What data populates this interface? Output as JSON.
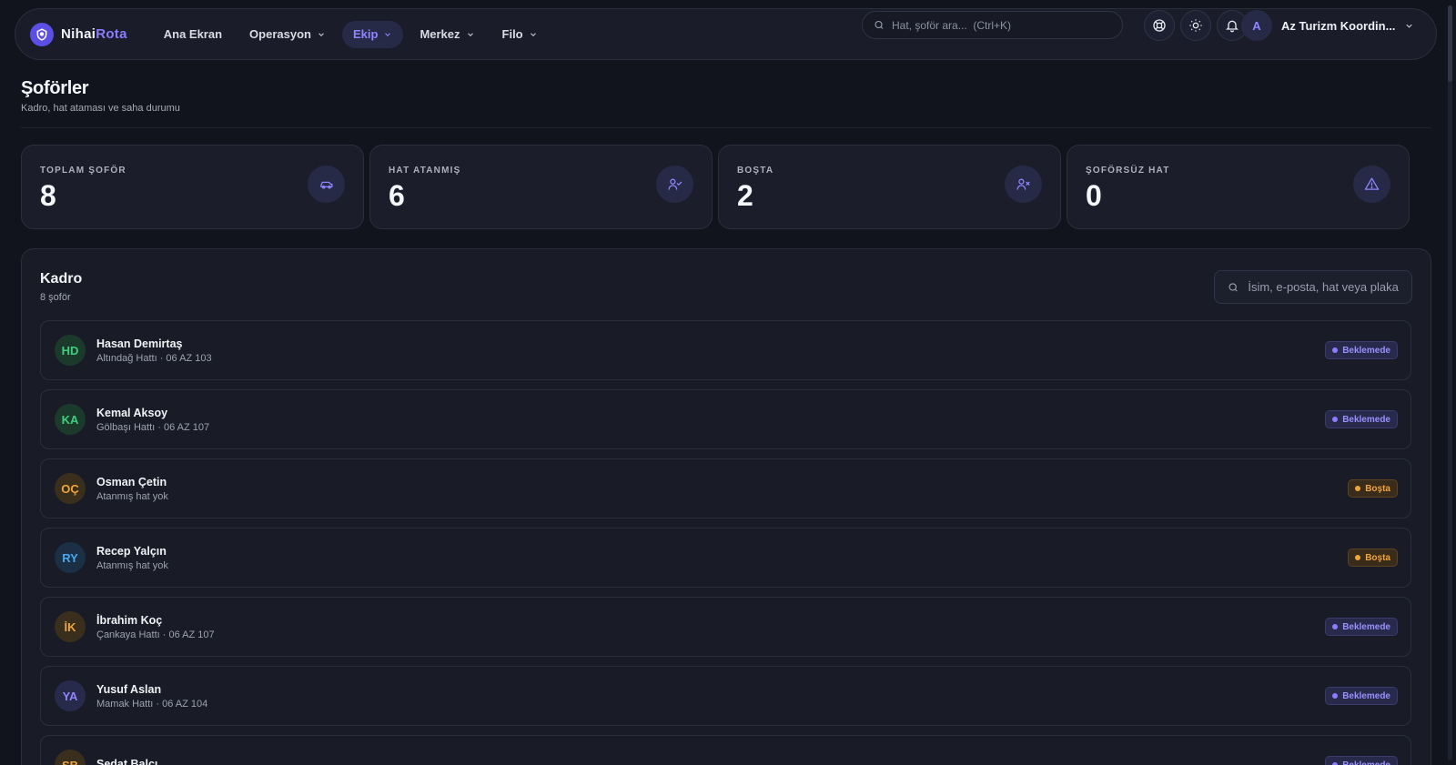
{
  "nav": {
    "logo_text_a": "Nihai",
    "logo_text_b": "Rota",
    "items": [
      {
        "label": "Ana Ekran",
        "has_menu": false,
        "active": false
      },
      {
        "label": "Operasyon",
        "has_menu": true,
        "active": false
      },
      {
        "label": "Ekip",
        "has_menu": true,
        "active": true
      },
      {
        "label": "Merkez",
        "has_menu": true,
        "active": false
      },
      {
        "label": "Filo",
        "has_menu": true,
        "active": false
      }
    ],
    "search_placeholder": "Hat, şoför ara...  (Ctrl+K)",
    "icons": [
      "support-icon",
      "sun-icon",
      "bell-icon"
    ],
    "user_initial": "A",
    "user_name": "Az Turizm Koordin..."
  },
  "header": {
    "title": "Şoförler",
    "subtitle": "Kadro, hat ataması ve saha durumu"
  },
  "stats": [
    {
      "label": "TOPLAM ŞOFÖR",
      "value": "8",
      "icon": "car-icon"
    },
    {
      "label": "HAT ATANMIŞ",
      "value": "6",
      "icon": "user-check-icon"
    },
    {
      "label": "BOŞTA",
      "value": "2",
      "icon": "user-x-icon"
    },
    {
      "label": "ŞOFÖRSÜZ HAT",
      "value": "0",
      "icon": "alert-triangle-icon"
    }
  ],
  "kadro": {
    "title": "Kadro",
    "count": "8 şoför",
    "search_placeholder": "İsim, e-posta, hat veya plaka",
    "drivers": [
      {
        "initials": "HD",
        "name": "Hasan Demirtaş",
        "detail": "Altındağ Hattı · 06 AZ 103",
        "status": "Beklemede",
        "status_kind": "wait",
        "avatar_bg": "#1c3a2c",
        "avatar_fg": "#3ecf7e"
      },
      {
        "initials": "KA",
        "name": "Kemal Aksoy",
        "detail": "Gölbaşı Hattı · 06 AZ 107",
        "status": "Beklemede",
        "status_kind": "wait",
        "avatar_bg": "#1c3a2c",
        "avatar_fg": "#3ecf7e"
      },
      {
        "initials": "OÇ",
        "name": "Osman Çetin",
        "detail": "Atanmış hat yok",
        "status": "Boşta",
        "status_kind": "idle",
        "avatar_bg": "#3a2e1c",
        "avatar_fg": "#f0a53a"
      },
      {
        "initials": "RY",
        "name": "Recep Yalçın",
        "detail": "Atanmış hat yok",
        "status": "Boşta",
        "status_kind": "idle",
        "avatar_bg": "#1b2f45",
        "avatar_fg": "#4aa8f0"
      },
      {
        "initials": "İK",
        "name": "İbrahim Koç",
        "detail": "Çankaya Hattı · 06 AZ 107",
        "status": "Beklemede",
        "status_kind": "wait",
        "avatar_bg": "#3a2e1c",
        "avatar_fg": "#f0a53a"
      },
      {
        "initials": "YA",
        "name": "Yusuf Aslan",
        "detail": "Mamak Hattı · 06 AZ 104",
        "status": "Beklemede",
        "status_kind": "wait",
        "avatar_bg": "#272a4a",
        "avatar_fg": "#8f85ff"
      },
      {
        "initials": "SB",
        "name": "Sedat Balcı",
        "detail": "",
        "status": "Beklemede",
        "status_kind": "wait",
        "avatar_bg": "#3a2e1c",
        "avatar_fg": "#f0a53a"
      }
    ]
  }
}
